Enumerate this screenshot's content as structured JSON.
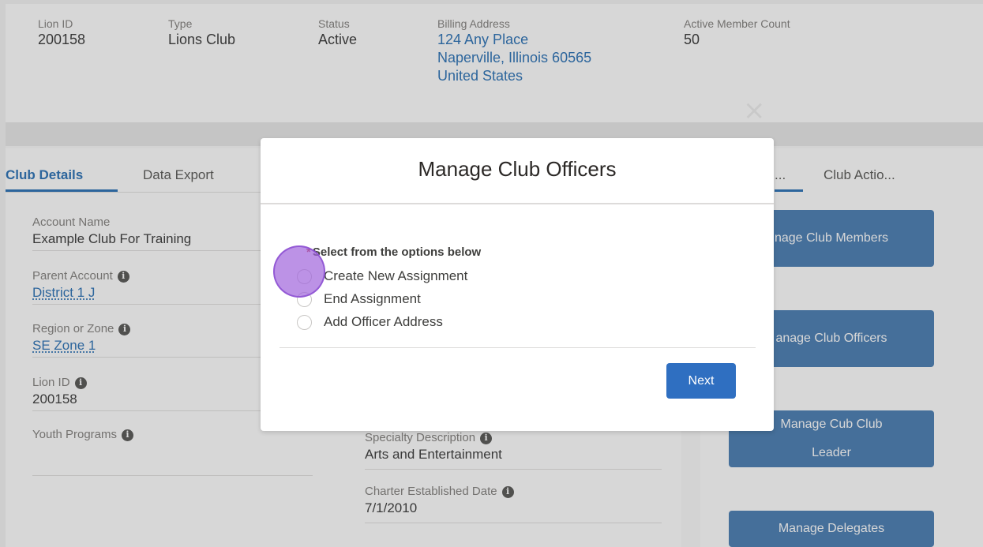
{
  "highlights": {
    "lion_id": {
      "label": "Lion ID",
      "value": "200158"
    },
    "type": {
      "label": "Type",
      "value": "Lions Club"
    },
    "status": {
      "label": "Status",
      "value": "Active"
    },
    "billing": {
      "label": "Billing Address",
      "line1": "124 Any Place",
      "line2": "Naperville, Illinois 60565",
      "line3": "United States"
    },
    "active_count": {
      "label": "Active Member Count",
      "value": "50"
    }
  },
  "tabs": {
    "club_details": "Club Details",
    "data_export": "Data Export"
  },
  "right_tabs": {
    "truncated": "...",
    "club_actions": "Club Actio..."
  },
  "details": {
    "account_name": {
      "label": "Account Name",
      "value": "Example Club For Training"
    },
    "parent_account": {
      "label": "Parent Account",
      "value": "District 1 J"
    },
    "region_zone": {
      "label": "Region or Zone",
      "value": "SE Zone 1"
    },
    "lion_id": {
      "label": "Lion ID",
      "value": "200158"
    },
    "youth_programs": {
      "label": "Youth Programs"
    },
    "specialty": {
      "label": "Specialty Description",
      "value": "Arts and Entertainment"
    },
    "charter": {
      "label": "Charter Established Date",
      "value": "7/1/2010"
    }
  },
  "actions": {
    "members": "nage Club Members",
    "officers": "anage Club Officers",
    "cub_line1": "Manage Cub Club",
    "cub_line2": "Leader",
    "delegates": "Manage Delegates"
  },
  "modal": {
    "title": "Manage Club Officers",
    "group_label": "Select from the options below",
    "required_mark": "*",
    "options": [
      "Create New Assignment",
      "End Assignment",
      "Add Officer Address"
    ],
    "next_label": "Next",
    "close_glyph": "×"
  },
  "icons": {
    "info": "info-icon",
    "close": "close-icon"
  },
  "colors": {
    "brand_blue": "#0b5cab",
    "button_blue": "#2f6fc1",
    "action_blue": "#2f6aa8"
  }
}
